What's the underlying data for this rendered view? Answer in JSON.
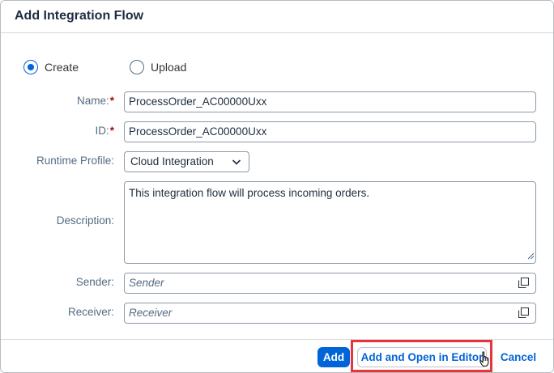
{
  "dialog": {
    "title": "Add Integration Flow"
  },
  "mode": {
    "create_label": "Create",
    "upload_label": "Upload",
    "selected": "Create"
  },
  "form": {
    "name_label": "Name:",
    "name_value": "ProcessOrder_AC00000Uxx",
    "id_label": "ID:",
    "id_value": "ProcessOrder_AC00000Uxx",
    "required_marker": "*",
    "runtime_label": "Runtime Profile:",
    "runtime_value": "Cloud Integration",
    "description_label": "Description:",
    "description_value": "This integration flow will process incoming orders.",
    "sender_label": "Sender:",
    "sender_placeholder": "Sender",
    "receiver_label": "Receiver:",
    "receiver_placeholder": "Receiver"
  },
  "footer": {
    "add_label": "Add",
    "add_open_label": "Add and Open in Editor",
    "cancel_label": "Cancel"
  },
  "colors": {
    "accent": "#0064d9",
    "required": "#aa0808",
    "highlight": "#e8343b"
  },
  "icons": {
    "value_help": "value-help-icon",
    "dropdown": "chevron-down-icon",
    "cursor": "hand-cursor-icon"
  }
}
